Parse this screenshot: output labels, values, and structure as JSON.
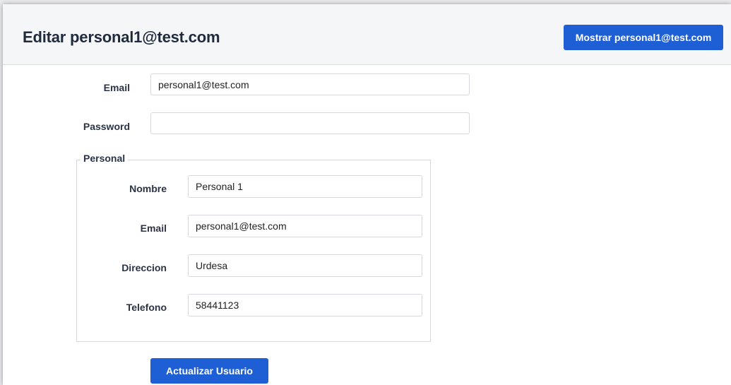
{
  "header": {
    "title": "Editar personal1@test.com",
    "show_button_label": "Mostrar personal1@test.com"
  },
  "form": {
    "email": {
      "label": "Email",
      "value": "personal1@test.com"
    },
    "password": {
      "label": "Password",
      "value": ""
    },
    "personal": {
      "legend": "Personal",
      "nombre": {
        "label": "Nombre",
        "value": "Personal 1"
      },
      "email": {
        "label": "Email",
        "value": "personal1@test.com"
      },
      "direccion": {
        "label": "Direccion",
        "value": "Urdesa"
      },
      "telefono": {
        "label": "Telefono",
        "value": "58441123"
      }
    },
    "submit_label": "Actualizar Usuario"
  },
  "colors": {
    "primary_button": "#1f5fd6",
    "header_background": "#f5f6f8"
  }
}
